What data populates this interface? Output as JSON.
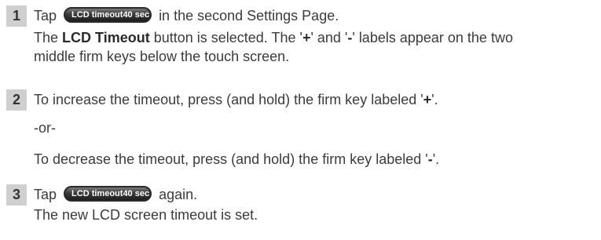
{
  "steps": [
    {
      "number": "1",
      "pre": "Tap",
      "button": {
        "label": "LCD timeout",
        "value": "40 sec"
      },
      "post": "in the second Settings Page.",
      "body_a": "The ",
      "body_bold": "LCD Timeout",
      "body_b": " button is selected. The '",
      "plus": "+",
      "body_c": "' and '",
      "minus": "-",
      "body_d": "' labels appear on the two",
      "body_2": "middle firm keys below the touch screen."
    },
    {
      "number": "2",
      "line1_a": "To increase the timeout, press (and hold) the firm key labeled '",
      "line1_bold": "+",
      "line1_b": "'.",
      "or": "-or-",
      "line2_a": "To decrease the timeout, press (and hold) the firm key labeled '",
      "line2_bold": "-",
      "line2_b": "'."
    },
    {
      "number": "3",
      "pre": "Tap",
      "button": {
        "label": "LCD timeout",
        "value": "40 sec"
      },
      "post": "again.",
      "body": "The new LCD screen timeout is set."
    }
  ]
}
